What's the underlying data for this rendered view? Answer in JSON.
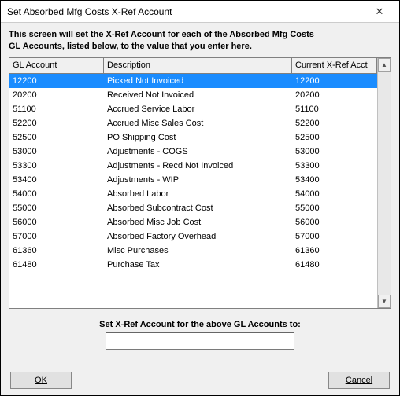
{
  "window": {
    "title": "Set Absorbed Mfg Costs X-Ref Account"
  },
  "instructions": {
    "line1": "This screen will set the X-Ref Account for each of the Absorbed Mfg Costs",
    "line2": "GL Accounts, listed below, to the value that you enter here."
  },
  "grid": {
    "headers": {
      "gl": "GL Account",
      "desc": "Description",
      "xref": "Current X-Ref Acct"
    },
    "rows": [
      {
        "gl": "12200",
        "desc": "Picked Not Invoiced",
        "xref": "12200",
        "selected": true
      },
      {
        "gl": "20200",
        "desc": "Received Not Invoiced",
        "xref": "20200",
        "selected": false
      },
      {
        "gl": "51100",
        "desc": "Accrued Service Labor",
        "xref": "51100",
        "selected": false
      },
      {
        "gl": "52200",
        "desc": "Accrued Misc Sales Cost",
        "xref": "52200",
        "selected": false
      },
      {
        "gl": "52500",
        "desc": "PO Shipping Cost",
        "xref": "52500",
        "selected": false
      },
      {
        "gl": "53000",
        "desc": "Adjustments - COGS",
        "xref": "53000",
        "selected": false
      },
      {
        "gl": "53300",
        "desc": "Adjustments - Recd Not Invoiced",
        "xref": "53300",
        "selected": false
      },
      {
        "gl": "53400",
        "desc": "Adjustments - WIP",
        "xref": "53400",
        "selected": false
      },
      {
        "gl": "54000",
        "desc": "Absorbed Labor",
        "xref": "54000",
        "selected": false
      },
      {
        "gl": "55000",
        "desc": "Absorbed Subcontract Cost",
        "xref": "55000",
        "selected": false
      },
      {
        "gl": "56000",
        "desc": "Absorbed Misc Job Cost",
        "xref": "56000",
        "selected": false
      },
      {
        "gl": "57000",
        "desc": "Absorbed Factory Overhead",
        "xref": "57000",
        "selected": false
      },
      {
        "gl": "61360",
        "desc": "Misc Purchases",
        "xref": "61360",
        "selected": false
      },
      {
        "gl": "61480",
        "desc": "Purchase Tax",
        "xref": "61480",
        "selected": false
      }
    ]
  },
  "prompt": {
    "label": "Set X-Ref Account for the above GL Accounts to:",
    "value": ""
  },
  "buttons": {
    "ok": "OK",
    "cancel": "Cancel"
  }
}
